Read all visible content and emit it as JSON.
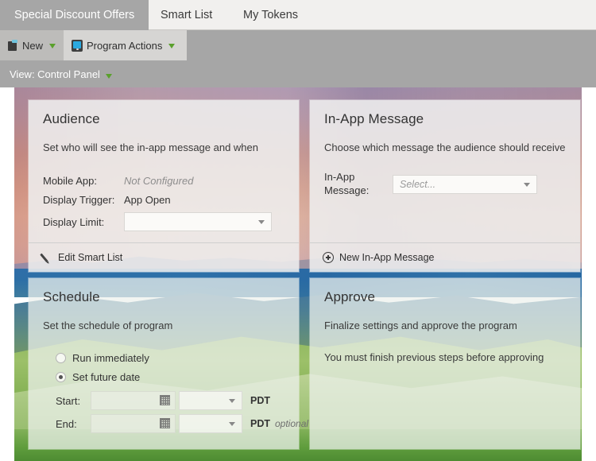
{
  "top_tabs": [
    {
      "label": "Special Discount Offers",
      "active": true
    },
    {
      "label": "Smart List",
      "active": false
    },
    {
      "label": "My Tokens",
      "active": false
    }
  ],
  "sub_tabs": [
    {
      "label": "New",
      "icon": "new-document-icon"
    },
    {
      "label": "Program Actions",
      "icon": "mobile-device-icon"
    }
  ],
  "view_bar": {
    "label": "View: Control Panel",
    "caret_icon": "caret-down-icon"
  },
  "cards": {
    "audience": {
      "title": "Audience",
      "description": "Set who will see the in-app message and when",
      "fields": [
        {
          "label": "Mobile App:",
          "value": "Not Configured",
          "muted": true
        },
        {
          "label": "Display Trigger:",
          "value": "App Open",
          "muted": false
        },
        {
          "label": "Display Limit:",
          "value": "",
          "muted": false
        }
      ],
      "footer_label": "Edit Smart List",
      "footer_icon": "pencil-icon"
    },
    "in_app_message": {
      "title": "In-App Message",
      "description": "Choose which message the audience should receive",
      "field_label_line1": "In-App",
      "field_label_line2": "Message:",
      "select_placeholder": "Select...",
      "footer_label": "New In-App Message",
      "footer_icon": "plus-circle-icon"
    },
    "schedule": {
      "title": "Schedule",
      "description": "Set the schedule of program",
      "radios": [
        {
          "label": "Run immediately",
          "checked": false
        },
        {
          "label": "Set future date",
          "checked": true
        }
      ],
      "start_label": "Start:",
      "start_date": "",
      "start_time": "",
      "start_tz": "PDT",
      "end_label": "End:",
      "end_date": "",
      "end_time": "",
      "end_tz": "PDT",
      "end_optional": "optional",
      "calendar_icon": "calendar-icon"
    },
    "approve": {
      "title": "Approve",
      "description": "Finalize settings and approve the program",
      "description2": "You must finish previous steps before approving"
    }
  },
  "colors": {
    "active_tab_bg": "#a6a6a6",
    "toolbar_bg": "#a6a6a6",
    "tabstrip_bg": "#f1f0ee",
    "card_bg": "#eeeeee",
    "caret_green": "#5aa02c",
    "device_blue": "#2aa9e0"
  }
}
